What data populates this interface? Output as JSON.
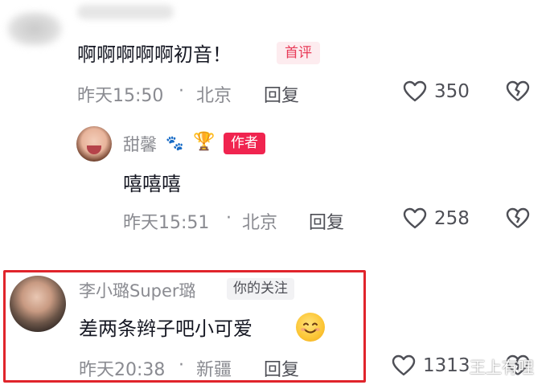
{
  "comments": [
    {
      "text": "啊啊啊啊啊初音！",
      "badge": "首评",
      "time": "昨天15:50",
      "separator": "·",
      "location": "北京",
      "reply_label": "回复",
      "likes": "350"
    },
    {
      "username": "甜馨",
      "badge": "作者",
      "text": "嘻嘻嘻",
      "time": "昨天15:51",
      "separator": "·",
      "location": "北京",
      "reply_label": "回复",
      "likes": "258"
    },
    {
      "username": "李小璐Super璐",
      "badge": "你的关注",
      "text": "差两条辫子吧小可爱",
      "time": "昨天20:38",
      "separator": "·",
      "location": "新疆",
      "reply_label": "回复",
      "likes": "1313"
    }
  ],
  "icons": {
    "like": "heart-outline-icon",
    "dislike": "broken-heart-icon",
    "paw": "paw-icon",
    "trophy": "trophy-icon",
    "emoji": "smile-emoji-icon"
  },
  "watermark": "王上有哩",
  "colors": {
    "first_badge_bg": "#fdecef",
    "first_badge_text": "#e83a57",
    "author_badge": "#f0244f",
    "highlight_border": "#e0242b",
    "meta_text": "#8a8b91"
  }
}
